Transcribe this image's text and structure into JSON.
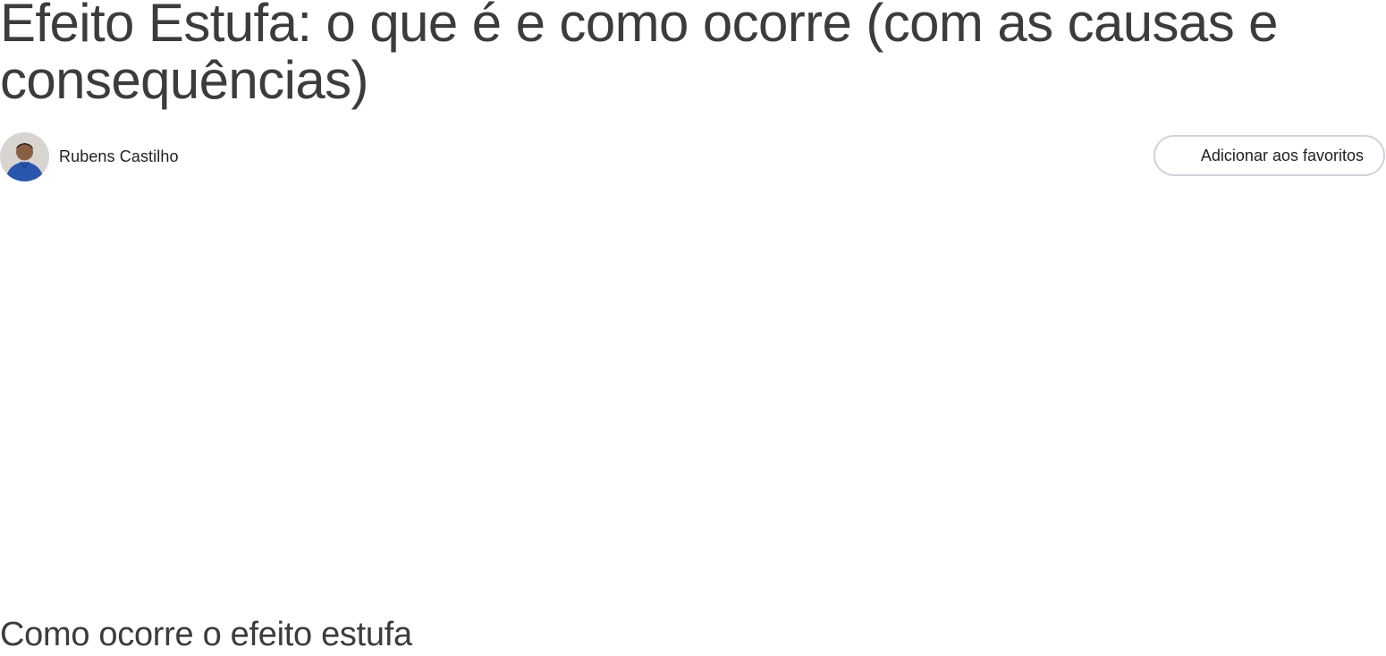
{
  "article": {
    "title": "Efeito Estufa: o que é e como ocorre (com as causas e consequências)",
    "author": {
      "name": "Rubens Castilho",
      "avatar_icon": "author-photo"
    },
    "favorites_button_label": "Adicionar aos favoritos",
    "section_heading": "Como ocorre o efeito estufa"
  },
  "colors": {
    "title_text": "#3c3c3c",
    "body_text": "#1f1f1f",
    "button_border": "#d2d2dc",
    "background": "#ffffff"
  }
}
